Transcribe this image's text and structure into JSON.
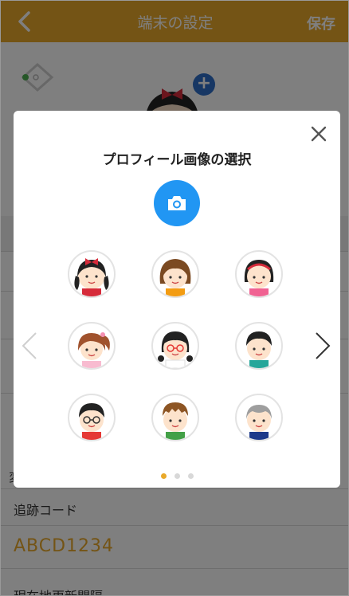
{
  "header": {
    "back_label": "back",
    "title": "端末の設定",
    "save_label": "保存"
  },
  "background": {
    "partial_label": "変",
    "tracking_code_label": "追跡コード",
    "tracking_code_value": "ABCD1234",
    "update_interval_label": "現在地更新間隔"
  },
  "modal": {
    "title": "プロフィール画像の選択",
    "camera_icon": "camera-icon",
    "close_icon": "close-icon",
    "avatars": [
      {
        "name": "girl-red-bow"
      },
      {
        "name": "girl-brown-bob"
      },
      {
        "name": "girl-black-headband"
      },
      {
        "name": "girl-side-ponytail"
      },
      {
        "name": "girl-glasses-braids"
      },
      {
        "name": "boy-black-hair"
      },
      {
        "name": "boy-glasses"
      },
      {
        "name": "boy-brown-hair"
      },
      {
        "name": "grandpa-gray-hair"
      }
    ],
    "page_count": 3,
    "active_page": 1
  },
  "colors": {
    "header": "#e9a92a",
    "camera_button": "#2196f3",
    "tracking_code": "#e9a92a",
    "active_dot": "#e9a92a"
  }
}
